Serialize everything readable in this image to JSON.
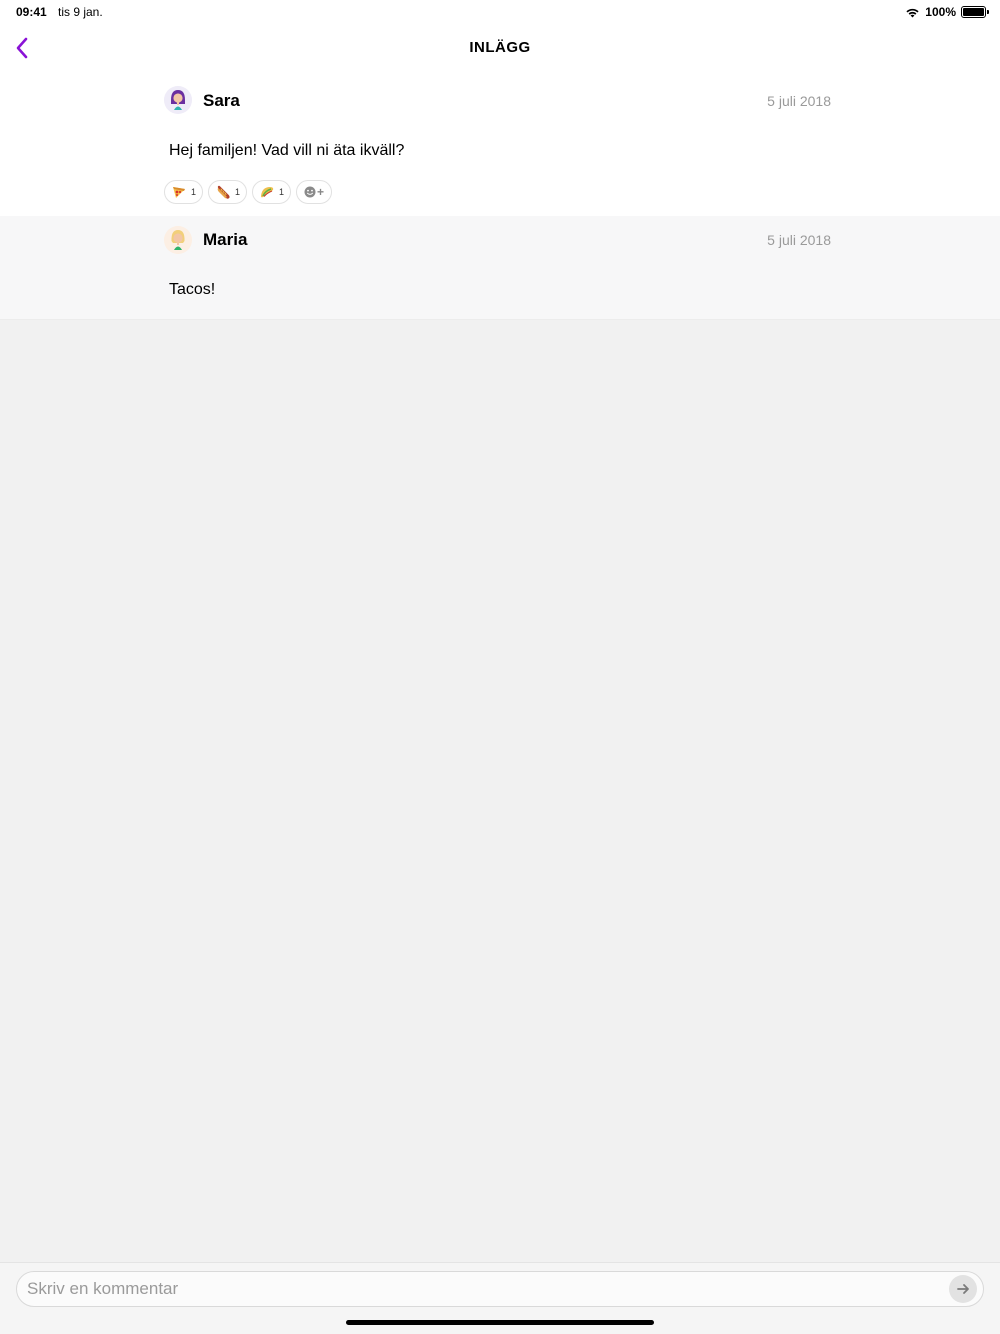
{
  "status_bar": {
    "time": "09:41",
    "date": "tis 9 jan.",
    "battery": "100%",
    "battery_level": 1.0
  },
  "nav": {
    "title": "INLÄGG",
    "back_icon": "chevron-left-icon",
    "accent_color": "#8a12d6"
  },
  "posts": [
    {
      "author": "Sara",
      "date": "5 juli 2018",
      "text": "Hej familjen!  Vad vill ni äta ikväll?",
      "avatar_icon": "woman-purple-hair-avatar",
      "reactions": [
        {
          "emoji": "pizza-icon",
          "count": "1"
        },
        {
          "emoji": "hotdog-icon",
          "count": "1"
        },
        {
          "emoji": "taco-icon",
          "count": "1"
        }
      ],
      "add_reaction_icon": "smiley-plus-icon"
    },
    {
      "author": "Maria",
      "date": "5 juli 2018",
      "text": "Tacos!",
      "avatar_icon": "woman-blonde-hair-avatar"
    }
  ],
  "comment": {
    "placeholder": "Skriv en kommentar",
    "value": "",
    "send_icon": "arrow-right-icon"
  }
}
